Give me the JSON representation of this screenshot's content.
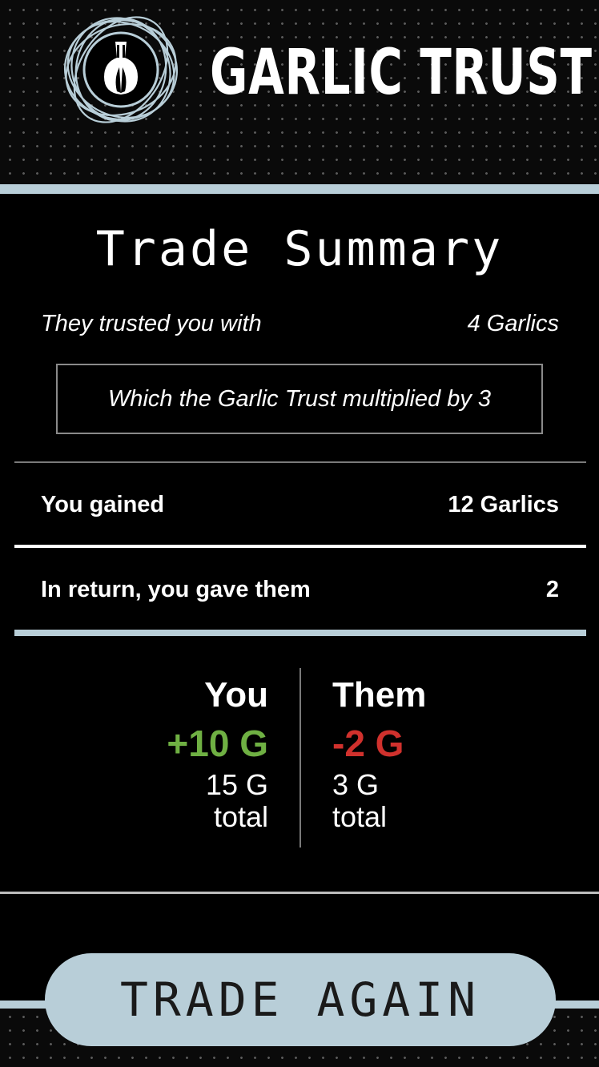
{
  "brand": {
    "name": "GARLIC TRUST",
    "logo_icon": "garlic-orbit-logo"
  },
  "summary": {
    "title": "Trade Summary",
    "trusted_label": "They trusted you with",
    "trusted_value": "4 Garlics",
    "multiplier_text": "Which the Garlic Trust multiplied by 3",
    "gained_label": "You gained",
    "gained_value": "12 Garlics",
    "gave_label": "In return, you gave them",
    "gave_value": "2"
  },
  "results": {
    "you": {
      "label": "You",
      "delta": "+10 G",
      "total": "15 G",
      "total_suffix": "total"
    },
    "them": {
      "label": "Them",
      "delta": "-2 G",
      "total": "3 G",
      "total_suffix": "total"
    }
  },
  "actions": {
    "trade_again": "TRADE AGAIN"
  },
  "colors": {
    "accent": "#b8ced8",
    "positive": "#6fb043",
    "negative": "#d0312d",
    "background": "#000000"
  }
}
